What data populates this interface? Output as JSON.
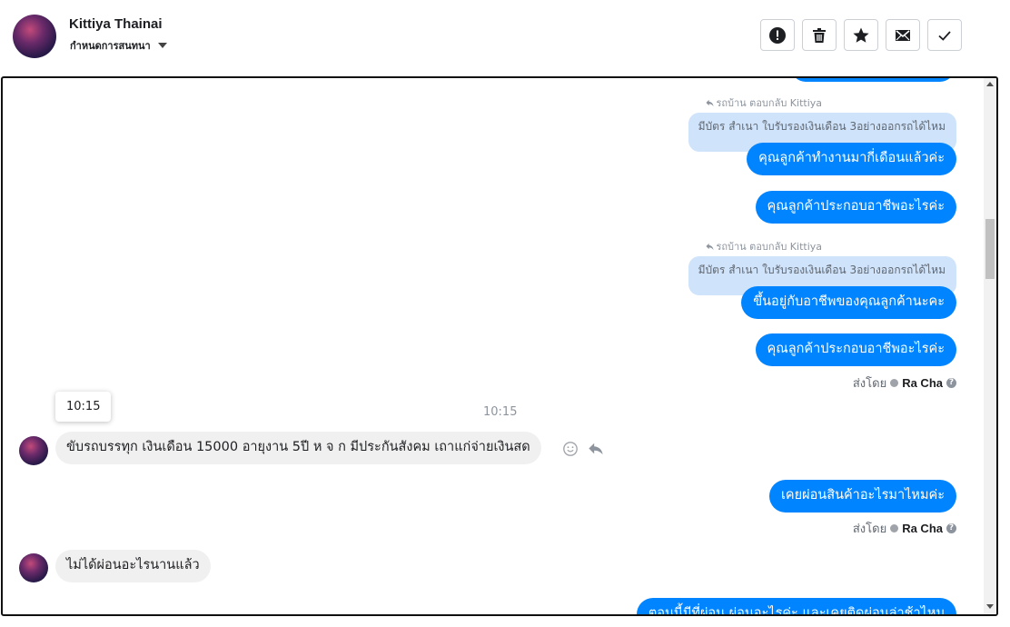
{
  "header": {
    "name": "Kittiya Thainai",
    "status": "กำหนดการสนทนา",
    "actions": [
      "mark-spam",
      "delete",
      "star",
      "mark-unread",
      "mark-done"
    ]
  },
  "thread": {
    "reply_meta_1": "รถบ้าน ตอบกลับ Kittiya",
    "quote_1": "มีบัตร สำเนา ใบรับรองเงินเดือน 3อย่างออกรถได้ไหม",
    "msg_out_1": "คุณลูกค้าทำงานมากี่เดือนแล้วค่ะ",
    "msg_out_2": "คุณลูกค้าประกอบอาชีพอะไรค่ะ",
    "reply_meta_2": "รถบ้าน ตอบกลับ Kittiya",
    "quote_2": "มีบัตร สำเนา ใบรับรองเงินเดือน 3อย่างออกรถได้ไหม",
    "msg_out_3": "ขึ้นอยู่กับอาชีพของคุณลูกค้านะคะ",
    "msg_out_4": "คุณลูกค้าประกอบอาชีพอะไรค่ะ",
    "sent_by_label_1": "ส่งโดย",
    "sent_by_agent_1": "Ra Cha",
    "tooltip_time": "10:15",
    "time_divider": "10:15",
    "msg_in_1": "ขับรถบรรทุก เงินเดือน 15000 อายุงาน 5ปี  ห จ ก มีประกันสังคม เถาแก่จ่ายเงินสด",
    "msg_out_5": "เคยผ่อนสินค้าอะไรมาไหมค่ะ",
    "sent_by_label_2": "ส่งโดย",
    "sent_by_agent_2": "Ra Cha",
    "msg_in_2": "ไม่ได้ผ่อนอะไรนานแล้ว",
    "msg_out_6": "ตอนนี้มีที่ผ่อน ผ่อนอะไรค่ะ และเคยติดผ่อนล่าช้าไหม"
  },
  "colors": {
    "outgoing_bubble": "#0084ff",
    "incoming_bubble": "#f1f0f0",
    "quote_bubble": "#cfe3fb"
  }
}
